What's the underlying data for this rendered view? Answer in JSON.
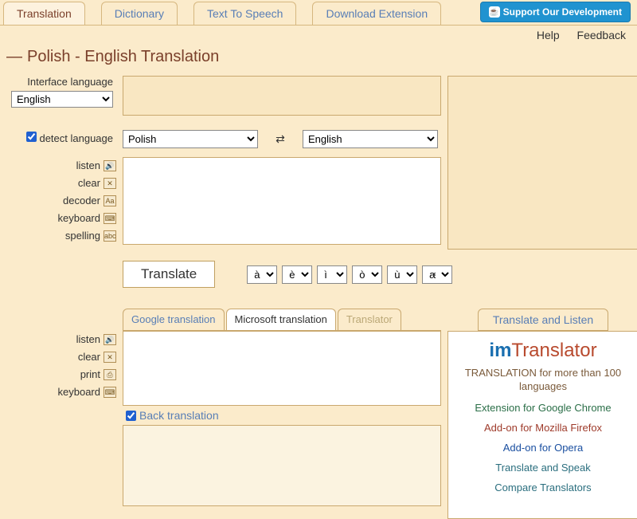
{
  "top_tabs": [
    "Translation",
    "Dictionary",
    "Text To Speech",
    "Download Extension"
  ],
  "support_btn": "Support Our Development",
  "help": "Help",
  "feedback": "Feedback",
  "page_title": "Polish - English Translation",
  "interface_label": "Interface language",
  "interface_value": "English",
  "detect_label": "detect language",
  "lang_from": "Polish",
  "lang_to": "English",
  "tools_a": {
    "listen": "listen",
    "clear": "clear",
    "decoder": "decoder",
    "keyboard": "keyboard",
    "spelling": "spelling"
  },
  "translate_btn": "Translate",
  "chars": [
    "à",
    "è",
    "ì",
    "ò",
    "ù",
    "æ"
  ],
  "sub_tabs": {
    "google": "Google translation",
    "microsoft": "Microsoft translation",
    "translator": "Translator"
  },
  "translate_listen": "Translate and Listen",
  "tools_b": {
    "listen": "listen",
    "clear": "clear",
    "print": "print",
    "keyboard": "keyboard"
  },
  "back_translation": "Back translation",
  "promo": {
    "logo_im": "im",
    "logo_rest": "Translator",
    "sub": "TRANSLATION for more than 100 languages",
    "chrome": "Extension for Google Chrome",
    "firefox": "Add-on for Mozilla Firefox",
    "opera": "Add-on for Opera",
    "speak": "Translate and Speak",
    "compare": "Compare Translators"
  }
}
